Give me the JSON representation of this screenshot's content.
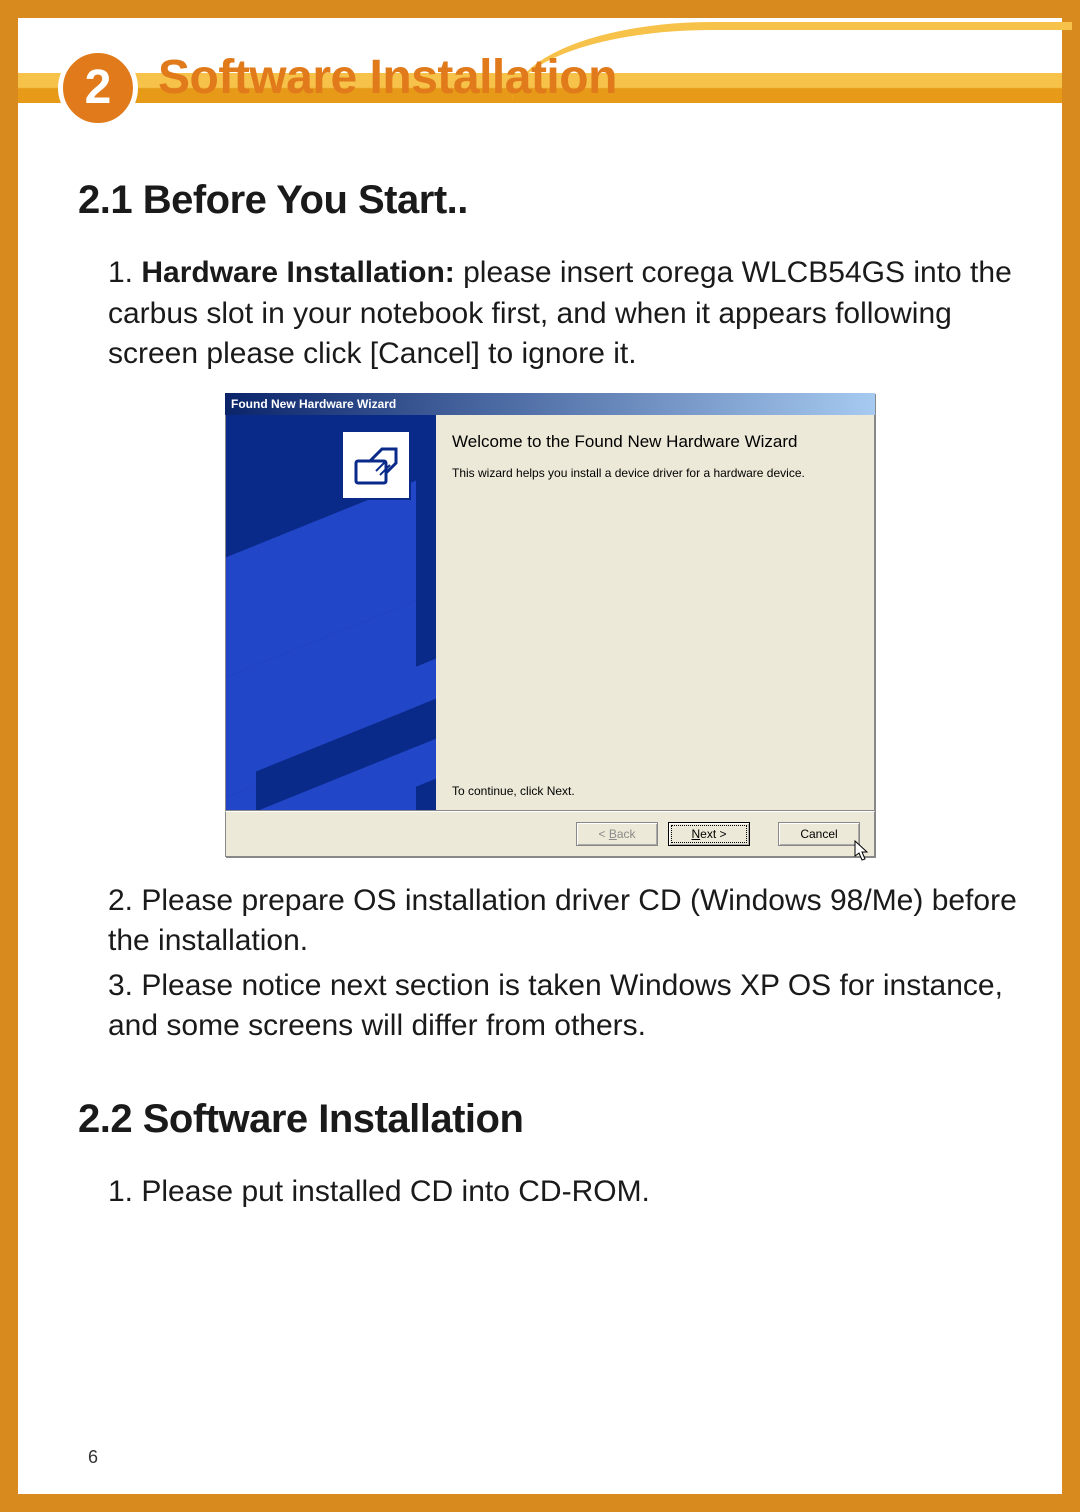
{
  "chapter": {
    "number": "2",
    "title": "Software Installation"
  },
  "section1": {
    "heading": "2.1 Before You Start..",
    "items": [
      {
        "num": "1.",
        "lead": "Hardware Installation: ",
        "text": "please insert corega WLCB54GS into the carbus slot in your notebook first, and when it appears following screen please click [Cancel] to ignore it."
      },
      {
        "num": "2.",
        "text": "Please prepare OS installation driver CD (Windows 98/Me) before the installation."
      },
      {
        "num": "3.",
        "text": "Please notice next section is taken Windows XP OS for instance, and some screens will differ from others."
      }
    ]
  },
  "wizard": {
    "title": "Found New Hardware Wizard",
    "heading": "Welcome to the Found New Hardware Wizard",
    "body": "This wizard helps you install a device driver for a hardware device.",
    "continue": "To continue, click Next.",
    "buttons": {
      "back": "< Back",
      "next": "Next >",
      "cancel": "Cancel"
    }
  },
  "section2": {
    "heading": "2.2 Software Installation",
    "items": [
      {
        "num": "1.",
        "text": "Please put installed CD into CD-ROM."
      }
    ]
  },
  "page_number": "6"
}
